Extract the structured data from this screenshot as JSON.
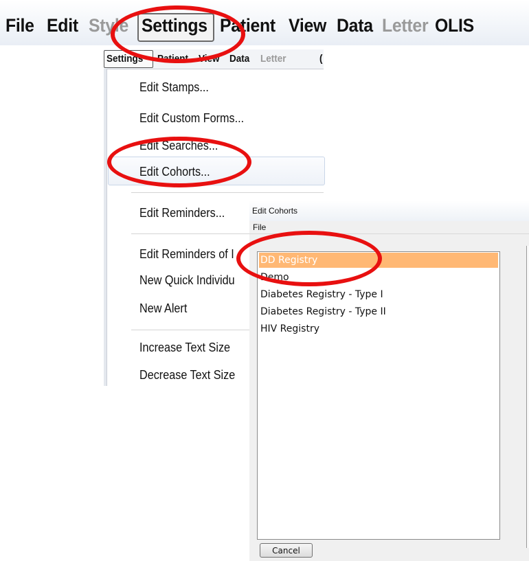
{
  "menubar": {
    "items": [
      {
        "label": "File",
        "disabled": false
      },
      {
        "label": "Edit",
        "disabled": false
      },
      {
        "label": "Style",
        "disabled": true
      },
      {
        "label": "Settings",
        "disabled": false
      },
      {
        "label": "Patient",
        "disabled": false
      },
      {
        "label": "View",
        "disabled": false
      },
      {
        "label": "Data",
        "disabled": false
      },
      {
        "label": "Letter",
        "disabled": true
      },
      {
        "label": "OLIS",
        "disabled": false
      }
    ]
  },
  "dropdown": {
    "menubar": {
      "items": [
        {
          "label": "Settings",
          "disabled": false
        },
        {
          "label": "Patient",
          "disabled": false
        },
        {
          "label": "View",
          "disabled": false
        },
        {
          "label": "Data",
          "disabled": false
        },
        {
          "label": "Letter",
          "disabled": true
        },
        {
          "label": "(",
          "disabled": false
        }
      ]
    },
    "items": [
      {
        "label": "Edit Stamps..."
      },
      {
        "label": "Edit Custom Forms..."
      },
      {
        "label": "Edit Searches..."
      },
      {
        "label": "Edit Cohorts..."
      },
      {
        "label": "Edit Reminders..."
      },
      {
        "label": "Edit Reminders of I"
      },
      {
        "label": "New Quick Individu"
      },
      {
        "label": "New Alert"
      },
      {
        "label": "Increase Text Size"
      },
      {
        "label": "Decrease Text Size"
      }
    ]
  },
  "dialog": {
    "title": "Edit Cohorts",
    "menu_file": "File",
    "list_items": [
      {
        "label": "DD Registry",
        "selected": true
      },
      {
        "label": "Demo",
        "selected": false
      },
      {
        "label": "Diabetes Registry - Type I",
        "selected": false
      },
      {
        "label": "Diabetes Registry - Type II",
        "selected": false
      },
      {
        "label": "HIV Registry",
        "selected": false
      }
    ],
    "cancel_label": "Cancel"
  },
  "colors": {
    "annotation": "#e81010",
    "selection": "#ffb874"
  }
}
